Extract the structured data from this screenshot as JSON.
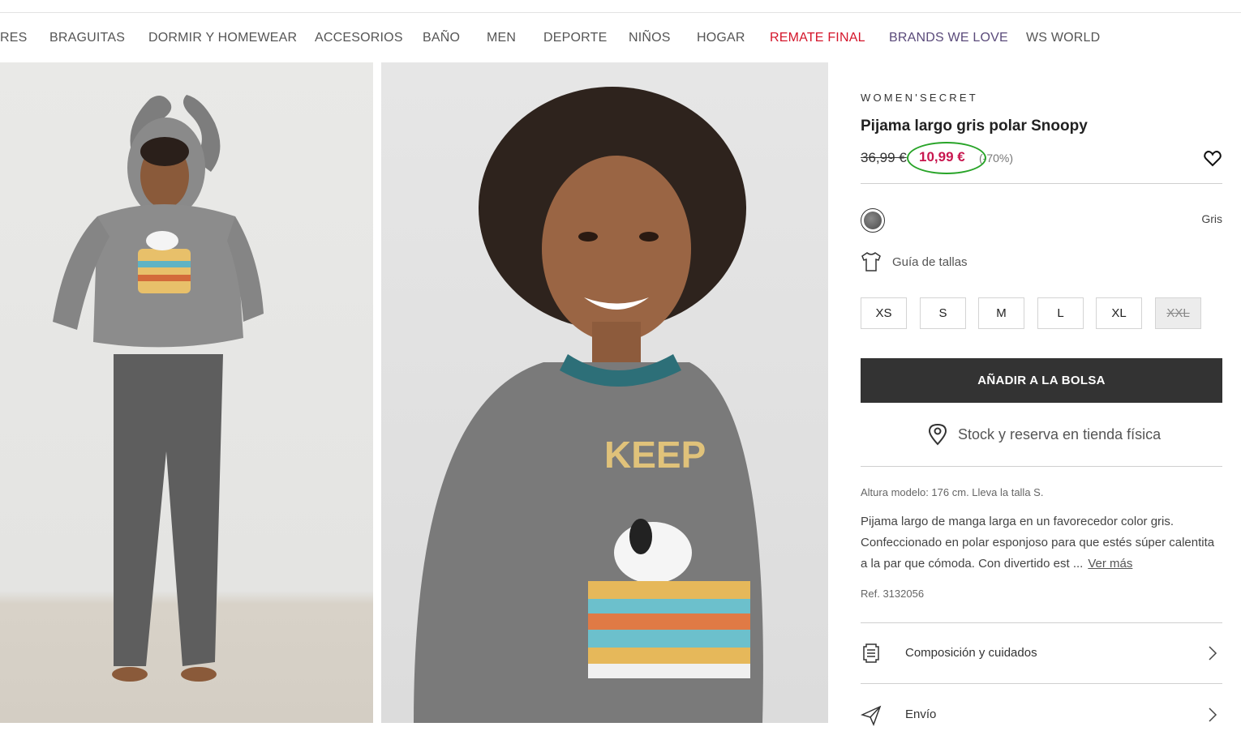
{
  "nav": {
    "items": [
      {
        "label": "RES",
        "style": "normal"
      },
      {
        "label": "BRAGUITAS",
        "style": "normal"
      },
      {
        "label": "DORMIR Y HOMEWEAR",
        "style": "normal"
      },
      {
        "label": "ACCESORIOS",
        "style": "normal"
      },
      {
        "label": "BAÑO",
        "style": "normal"
      },
      {
        "label": "MEN",
        "style": "normal"
      },
      {
        "label": "DEPORTE",
        "style": "normal"
      },
      {
        "label": "NIÑOS",
        "style": "normal"
      },
      {
        "label": "HOGAR",
        "style": "normal"
      },
      {
        "label": "REMATE FINAL",
        "style": "red"
      },
      {
        "label": "BRANDS WE LOVE",
        "style": "purple"
      },
      {
        "label": "WS WORLD",
        "style": "normal"
      }
    ]
  },
  "product": {
    "brand": "WOMEN'SECRET",
    "title": "Pijama largo gris polar Snoopy",
    "old_price": "36,99 €",
    "new_price": "10,99 €",
    "discount": "(-70%)",
    "color_name": "Gris",
    "size_guide": "Guía de tallas",
    "sizes": [
      {
        "label": "XS",
        "available": true
      },
      {
        "label": "S",
        "available": true
      },
      {
        "label": "M",
        "available": true
      },
      {
        "label": "L",
        "available": true
      },
      {
        "label": "XL",
        "available": true
      },
      {
        "label": "XXL",
        "available": false
      }
    ],
    "add_to_bag": "AÑADIR A LA BOLSA",
    "stock": "Stock y reserva en tienda física",
    "model_info": "Altura modelo: 176 cm.  Lleva la talla S.",
    "description": "Pijama largo de manga larga en un favorecedor color gris. Confeccionado en polar esponjoso para que estés súper calentita a la par que cómoda. Con divertido est ...",
    "see_more": "Ver más",
    "ref": "Ref. 3132056"
  },
  "accordion": [
    {
      "label": "Composición y cuidados",
      "icon": "care-label-icon"
    },
    {
      "label": "Envío",
      "icon": "send-icon"
    }
  ],
  "colors": {
    "sale": "#c8174f",
    "accent_red": "#d4152a",
    "accent_purple": "#5a4a7a",
    "button_dark": "#333333",
    "highlight_circle": "#28a428"
  }
}
